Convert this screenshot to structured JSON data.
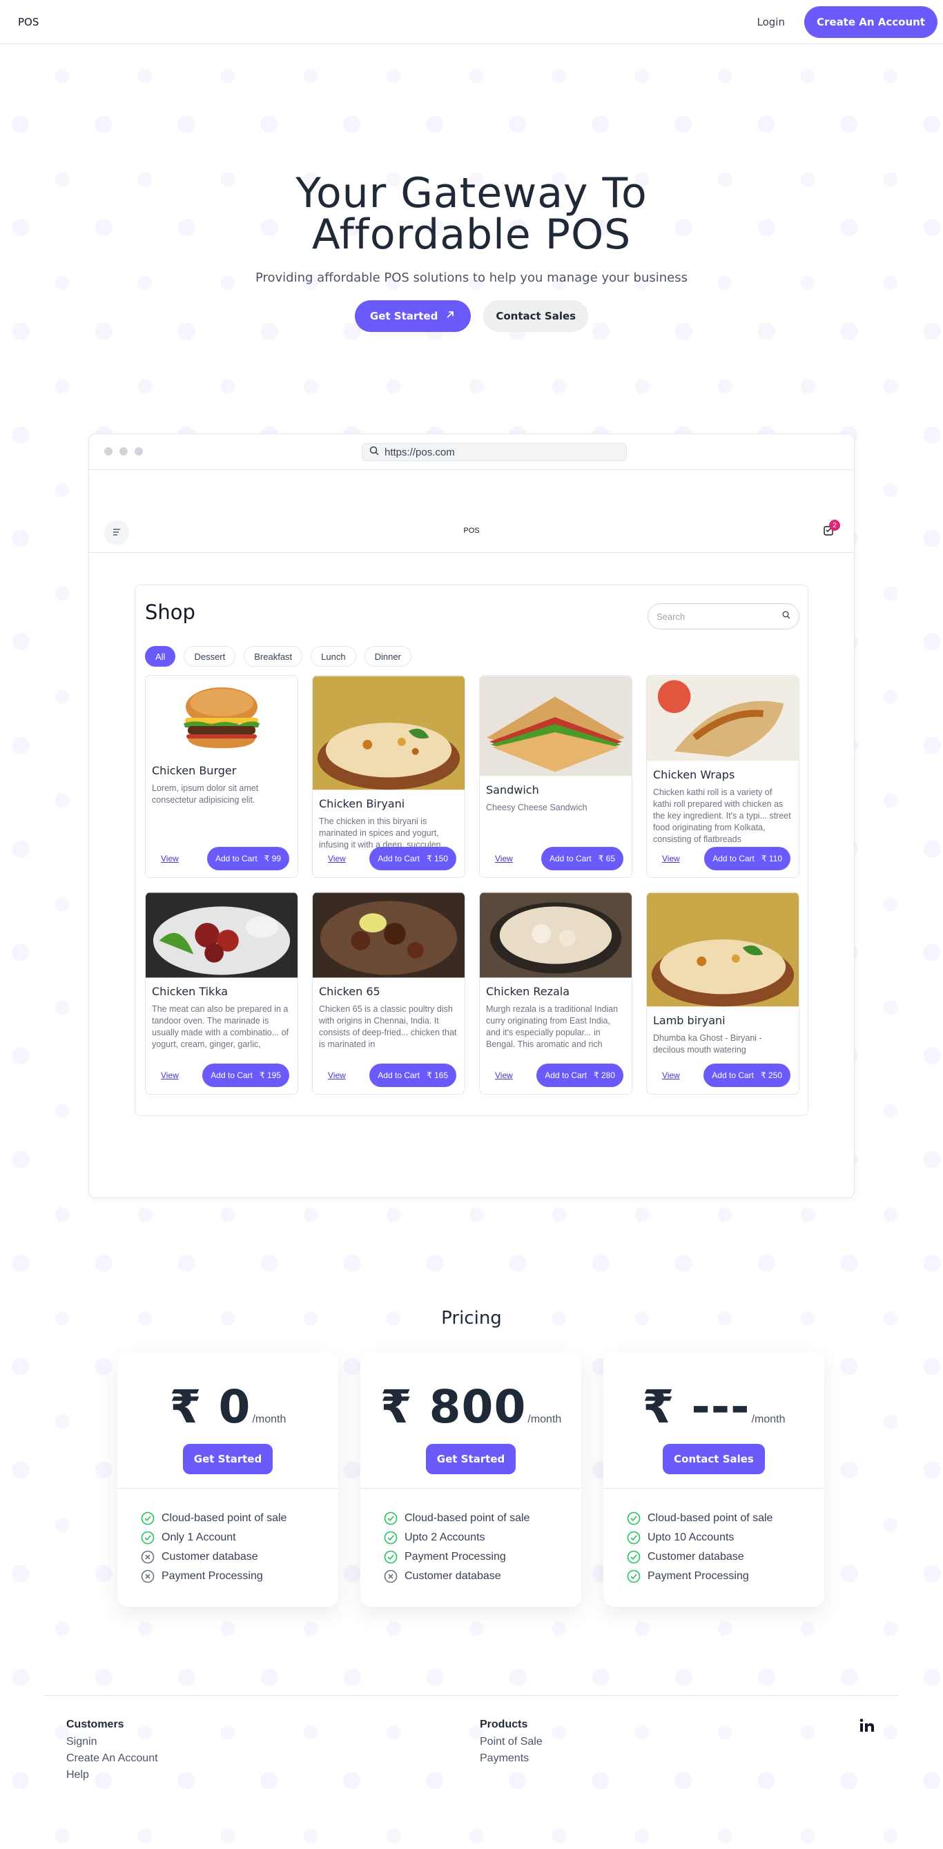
{
  "nav": {
    "brand": "POS",
    "login": "Login",
    "create_account": "Create An Account"
  },
  "hero": {
    "title_line1": "Your Gateway To",
    "title_line2": "Affordable POS",
    "subtitle": "Providing affordable POS solutions to help you manage your business",
    "get_started": "Get Started",
    "contact_sales": "Contact Sales"
  },
  "browser": {
    "url": "https://pos.com"
  },
  "app": {
    "title": "POS",
    "cart_count": "2"
  },
  "shop": {
    "title": "Shop",
    "search_placeholder": "Search",
    "categories": [
      "All",
      "Dessert",
      "Breakfast",
      "Lunch",
      "Dinner"
    ],
    "view_label": "View",
    "add_label": "Add to Cart",
    "products": [
      {
        "name": "Chicken Burger",
        "desc": "Lorem, ipsum dolor sit amet consectetur adipisicing elit.",
        "price": "₹ 99",
        "image": "burger"
      },
      {
        "name": "Chicken Biryani",
        "desc": "The chicken in this biryani is marinated in spices and yogurt, infusing it with a deep, succulen...",
        "price": "₹ 150",
        "image": "biryani"
      },
      {
        "name": "Sandwich",
        "desc": "Cheesy Cheese Sandwich",
        "price": "₹ 65",
        "image": "sandwich"
      },
      {
        "name": "Chicken Wraps",
        "desc": "Chicken kathi roll is a variety of kathi roll prepared with chicken as the key ingredient. It's a typi... street food originating from Kolkata, consisting of flatbreads",
        "price": "₹ 110",
        "image": "wrap"
      },
      {
        "name": "Chicken Tikka",
        "desc": "The meat can also be prepared in a tandoor oven. The marinade is usually made with a combinatio... of yogurt, cream, ginger, garlic,",
        "price": "₹ 195",
        "image": "tikka"
      },
      {
        "name": "Chicken 65",
        "desc": "Chicken 65 is a classic poultry dish with origins in Chennai, India. It consists of deep-fried... chicken that is marinated in",
        "price": "₹ 165",
        "image": "chicken65"
      },
      {
        "name": "Chicken Rezala",
        "desc": "Murgh rezala is a traditional Indian curry originating from East India, and it's especially popular... in Bengal. This aromatic and rich",
        "price": "₹ 280",
        "image": "rezala"
      },
      {
        "name": "Lamb biryani",
        "desc": "Dhumba ka Ghost - Biryani - decilous mouth watering",
        "price": "₹ 250",
        "image": "biryani"
      }
    ]
  },
  "pricing": {
    "title": "Pricing",
    "plans": [
      {
        "amount": "₹ 0",
        "period": "/month",
        "button": "Get Started",
        "features": [
          {
            "text": "Cloud-based point of sale",
            "included": true
          },
          {
            "text": "Only 1 Account",
            "included": true
          },
          {
            "text": "Customer database",
            "included": false
          },
          {
            "text": "Payment Processing",
            "included": false
          }
        ]
      },
      {
        "amount": "₹ 800",
        "period": "/month",
        "button": "Get Started",
        "features": [
          {
            "text": "Cloud-based point of sale",
            "included": true
          },
          {
            "text": "Upto 2 Accounts",
            "included": true
          },
          {
            "text": "Payment Processing",
            "included": true
          },
          {
            "text": "Customer database",
            "included": false
          }
        ]
      },
      {
        "amount": "₹ ---",
        "period": "/month",
        "button": "Contact Sales",
        "features": [
          {
            "text": "Cloud-based point of sale",
            "included": true
          },
          {
            "text": "Upto 10 Accounts",
            "included": true
          },
          {
            "text": "Customer database",
            "included": true
          },
          {
            "text": "Payment Processing",
            "included": true
          }
        ]
      }
    ]
  },
  "footer": {
    "customers": {
      "heading": "Customers",
      "links": [
        "Signin",
        "Create An Account",
        "Help"
      ]
    },
    "products": {
      "heading": "Products",
      "links": [
        "Point of Sale",
        "Payments"
      ]
    },
    "social_icon": "linkedin-icon"
  },
  "colors": {
    "accent": "#6a5af9",
    "check": "#22c55e",
    "badge": "#db2777"
  }
}
